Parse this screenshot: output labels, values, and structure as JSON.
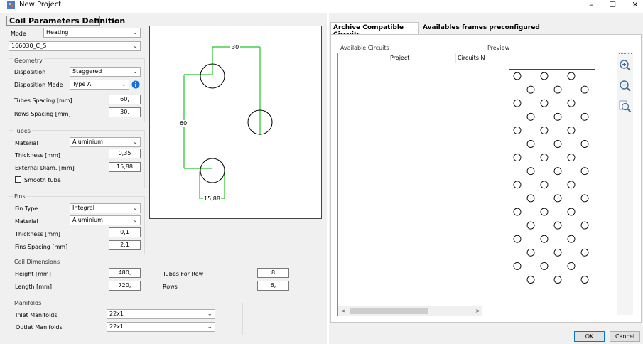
{
  "window": {
    "title": "New Project",
    "minimize": "–",
    "maximize": "☐",
    "close": "✕"
  },
  "coil": {
    "section_title": "Coil Parameters Definition",
    "mode_label": "Mode",
    "mode_value": "Heating",
    "circuit_value": "166030_C_S"
  },
  "geometry": {
    "group": "Geometry",
    "disposition_label": "Disposition",
    "disposition_value": "Staggered",
    "disposition_mode_label": "Disposition Mode",
    "disposition_mode_value": "Type A",
    "tubes_spacing_label": "Tubes Spacing [mm]",
    "tubes_spacing_value": "60,",
    "rows_spacing_label": "Rows Spacing [mm]",
    "rows_spacing_value": "30,"
  },
  "tubes": {
    "group": "Tubes",
    "material_label": "Material",
    "material_value": "Aluminium",
    "thickness_label": "Thickness [mm]",
    "thickness_value": "0,35",
    "ext_diam_label": "External Diam. [mm]",
    "ext_diam_value": "15,88",
    "smooth_label": "Smooth tube"
  },
  "fins": {
    "group": "Fins",
    "type_label": "Fin Type",
    "type_value": "Integral",
    "material_label": "Material",
    "material_value": "Aluminium",
    "thickness_label": "Thickness [mm]",
    "thickness_value": "0,1",
    "spacing_label": "Fins Spacing [mm]",
    "spacing_value": "2,1"
  },
  "dimensions": {
    "group": "Coil Dimensions",
    "height_label": "Height [mm]",
    "height_value": "480,",
    "length_label": "Length [mm]",
    "length_value": "720,",
    "tubes_row_label": "Tubes For Row",
    "tubes_row_value": "8",
    "rows_label": "Rows",
    "rows_value": "6,"
  },
  "manifolds": {
    "group": "Manifolds",
    "inlet_label": "Inlet Manifolds",
    "inlet_value": "22x1",
    "outlet_label": "Outlet Manifolds",
    "outlet_value": "22x1"
  },
  "diagram": {
    "dim_30": "30",
    "dim_60": "60",
    "dim_1588": "15,88"
  },
  "tabs": {
    "archive": "Archive Compatible Circuits",
    "frames": "Availables frames preconfigured"
  },
  "circuits": {
    "available_label": "Available Circuits",
    "col_project": "Project",
    "col_circuits": "Circuits N",
    "scroll_left": "<",
    "scroll_right": ">"
  },
  "preview": {
    "label": "Preview",
    "rows": 6,
    "tubes_per_row": 8
  },
  "buttons": {
    "ok": "OK",
    "cancel": "Cancel"
  },
  "icons": {
    "info": "info-icon",
    "zoom_in": "zoom-in-icon",
    "zoom_out": "zoom-out-icon",
    "zoom_fit": "zoom-fit-icon"
  },
  "colors": {
    "dimension_line": "#22c622",
    "info": "#1a6fd6"
  }
}
